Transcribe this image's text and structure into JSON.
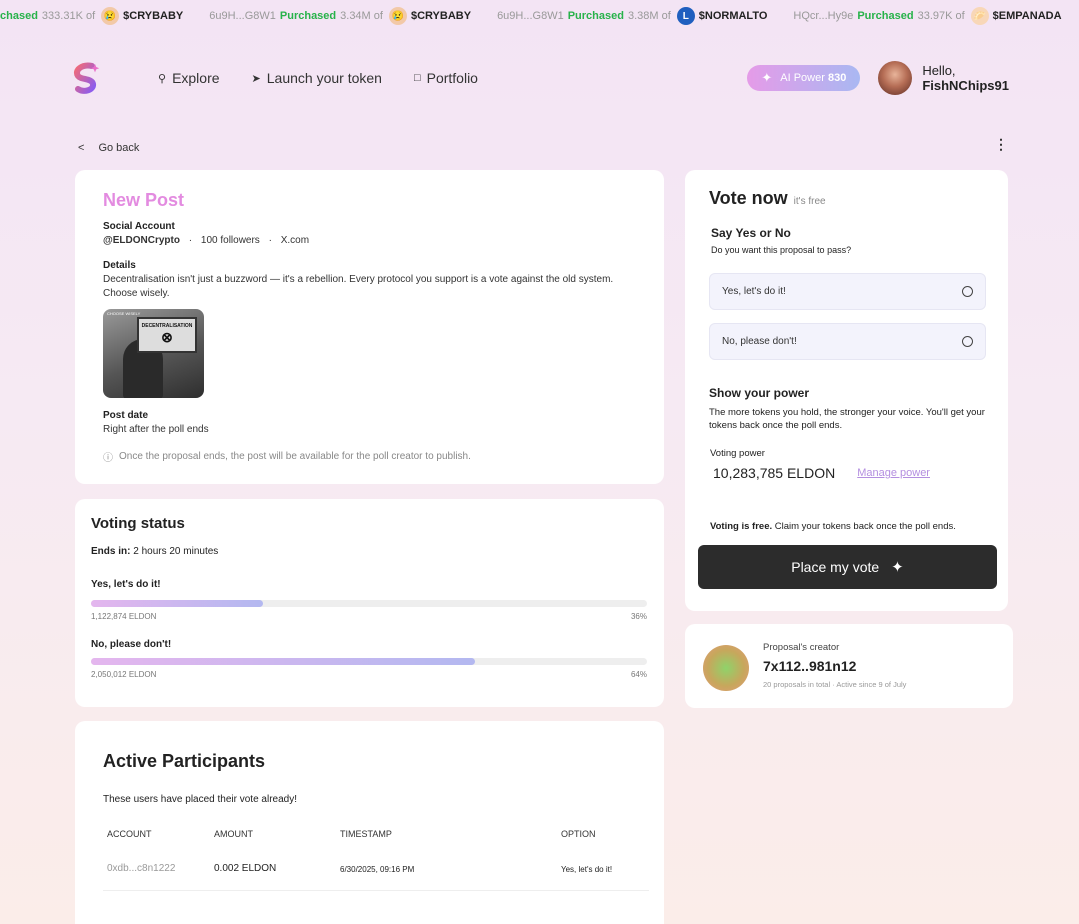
{
  "ticker": [
    {
      "addr": "",
      "action": "chased",
      "amount": "333.31K of",
      "symbol": "$CRYBABY",
      "icon_color": "#e07a3f"
    },
    {
      "addr": "6u9H...G8W1",
      "action": "Purchased",
      "amount": "3.34M of",
      "symbol": "$CRYBABY",
      "icon_color": "#e07a3f"
    },
    {
      "addr": "6u9H...G8W1",
      "action": "Purchased",
      "amount": "3.38M of",
      "symbol": "$NORMALTO",
      "icon_color": "#1f5fbf",
      "icon_text": "L"
    },
    {
      "addr": "HQcr...Hy9e",
      "action": "Purchased",
      "amount": "33.97K of",
      "symbol": "$EMPANADA",
      "icon_color": "#f08a2e"
    }
  ],
  "nav": {
    "explore": "Explore",
    "launch": "Launch your token",
    "portfolio": "Portfolio",
    "ai_label": "AI Power",
    "ai_value": "830",
    "hello": "Hello,",
    "username": "FishNChips91"
  },
  "goback": {
    "chevron": "<",
    "label": "Go back"
  },
  "kebab": "⋮",
  "post": {
    "title": "New Post",
    "social_label": "Social Account",
    "handle": "@ELDONCrypto",
    "followers": "100 followers",
    "platform": "X.com",
    "details_label": "Details",
    "details": "Decentralisation isn't just a buzzword — it's a rebellion. Every protocol you support is a vote against the old system. Choose wisely.",
    "image_tag": "CHOOSE WISELY",
    "image_sign": "DECENTRALISATION",
    "post_date_label": "Post date",
    "post_date": "Right after the poll ends",
    "note": "Once the proposal ends, the post will be available for the poll creator to publish."
  },
  "status": {
    "title": "Voting status",
    "ends_label": "Ends in:",
    "ends_value": "2 hours 20 minutes",
    "options": [
      {
        "label": "Yes, let's do it!",
        "amount": "1,122,874 ELDON",
        "pct_label": "36%",
        "pct": 0.31
      },
      {
        "label": "No, please don't!",
        "amount": "2,050,012 ELDON",
        "pct_label": "64%",
        "pct": 0.69
      }
    ]
  },
  "participants": {
    "title": "Active Participants",
    "subtitle": "These users have placed their vote already!",
    "headers": [
      "ACCOUNT",
      "AMOUNT",
      "TIMESTAMP",
      "OPTION"
    ],
    "rows": [
      {
        "account": "0xdb...c8n1222",
        "amount": "0.002 ELDON",
        "timestamp": "6/30/2025, 09:16 PM",
        "option": "Yes, let's do it!"
      }
    ]
  },
  "vote": {
    "title": "Vote now",
    "free": "it's free",
    "q_title": "Say Yes or No",
    "q_sub": "Do you want this proposal to pass?",
    "opt_yes": "Yes, let's do it!",
    "opt_no": "No, please don't!",
    "power_title": "Show your power",
    "power_text": "The more tokens you hold, the stronger your voice. You'll get your tokens back once the poll ends.",
    "vp_label": "Voting power",
    "vp_value": "10,283,785 ELDON",
    "manage": "Manage power",
    "free_bold": "Voting is free.",
    "free_rest": "Claim your tokens back once the poll ends.",
    "button": "Place my vote"
  },
  "creator": {
    "label": "Proposal's creator",
    "address": "7x112..981n12",
    "meta": "20 proposals in total · Active since 9 of July"
  }
}
